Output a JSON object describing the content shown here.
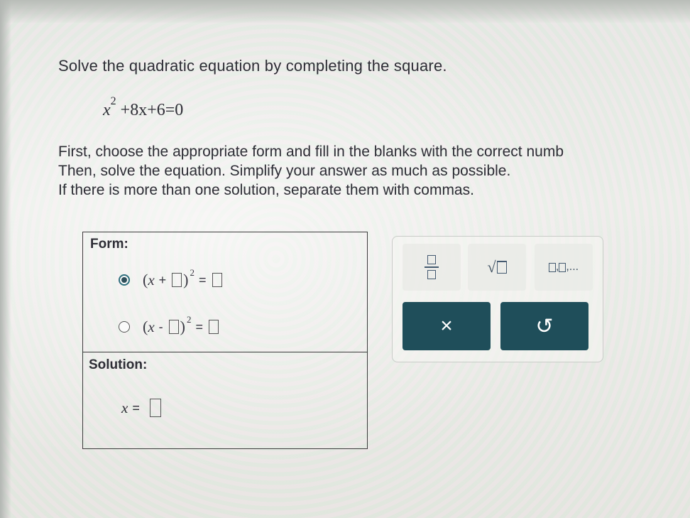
{
  "question": {
    "title": "Solve the quadratic equation by completing the square.",
    "equation": {
      "base": "x",
      "exponent": "2",
      "rest": "+8x+6=0"
    },
    "instructions": [
      "First, choose the appropriate form and fill in the blanks with the correct numb",
      "Then, solve the equation. Simplify your answer as much as possible.",
      "If there is more than one solution, separate them with commas."
    ]
  },
  "form": {
    "label": "Form:",
    "options": [
      {
        "open": "(",
        "var": "x",
        "sign": "+",
        "close": ")",
        "exponent": "2",
        "equals": "=",
        "selected": true
      },
      {
        "open": "(",
        "var": "x",
        "sign": "-",
        "close": ")",
        "exponent": "2",
        "equals": "=",
        "selected": false
      }
    ]
  },
  "solution": {
    "label": "Solution:",
    "var": "x",
    "equals": "="
  },
  "keypad": {
    "fraction_icon": "fraction-icon",
    "sqrt_symbol": "√",
    "list_suffix": ",...",
    "clear_symbol": "×",
    "undo_symbol": "↺",
    "action_color": "#1f4e5a"
  }
}
